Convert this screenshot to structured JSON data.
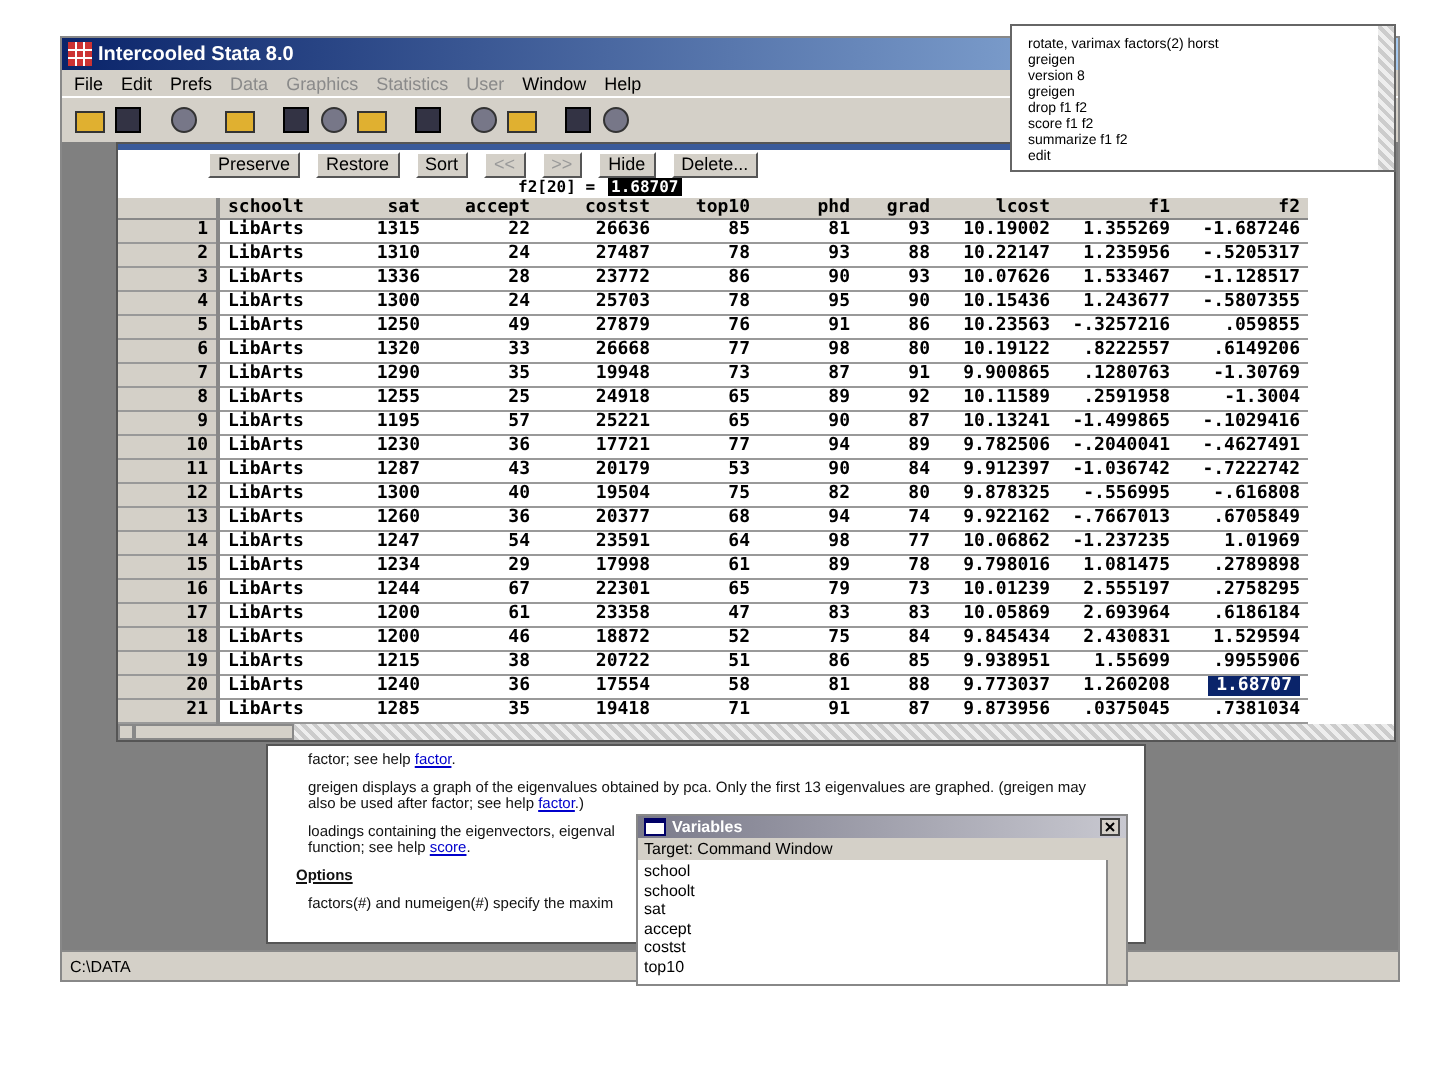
{
  "window": {
    "title": "Intercooled Stata 8.0"
  },
  "menu": [
    {
      "label": "File",
      "disabled": false
    },
    {
      "label": "Edit",
      "disabled": false
    },
    {
      "label": "Prefs",
      "disabled": false
    },
    {
      "label": "Data",
      "disabled": true
    },
    {
      "label": "Graphics",
      "disabled": true
    },
    {
      "label": "Statistics",
      "disabled": true
    },
    {
      "label": "User",
      "disabled": true
    },
    {
      "label": "Window",
      "disabled": false
    },
    {
      "label": "Help",
      "disabled": false
    }
  ],
  "review": {
    "lines": [
      "rotate, varimax factors(2) horst",
      "greigen",
      "version 8",
      "greigen",
      "drop f1 f2",
      "score f1 f2",
      "summarize f1 f2",
      "edit"
    ]
  },
  "data_editor": {
    "buttons": [
      {
        "label": "Preserve",
        "disabled": false
      },
      {
        "label": "Restore",
        "disabled": false
      },
      {
        "label": "Sort",
        "disabled": false
      },
      {
        "label": "<<",
        "disabled": true
      },
      {
        "label": ">>",
        "disabled": true
      },
      {
        "label": "Hide",
        "disabled": false
      },
      {
        "label": "Delete...",
        "disabled": false
      }
    ],
    "cell_reference": "f2[20] =",
    "cell_value": "1.68707",
    "columns": [
      {
        "label": "schoolt",
        "kind": "text"
      },
      {
        "label": "sat",
        "kind": "number"
      },
      {
        "label": "accept",
        "kind": "number"
      },
      {
        "label": "costst",
        "kind": "number"
      },
      {
        "label": "top10",
        "kind": "number"
      },
      {
        "label": "phd",
        "kind": "number"
      },
      {
        "label": "grad",
        "kind": "number"
      },
      {
        "label": "lcost",
        "kind": "number"
      },
      {
        "label": "f1",
        "kind": "number"
      },
      {
        "label": "f2",
        "kind": "number"
      }
    ],
    "rows": [
      {
        "number": "1",
        "cells": [
          {
            "text": "LibArts",
            "selected": false
          },
          {
            "text": "1315",
            "selected": false
          },
          {
            "text": "22",
            "selected": false
          },
          {
            "text": "26636",
            "selected": false
          },
          {
            "text": "85",
            "selected": false
          },
          {
            "text": "81",
            "selected": false
          },
          {
            "text": "93",
            "selected": false
          },
          {
            "text": "10.19002",
            "selected": false
          },
          {
            "text": "1.355269",
            "selected": false
          },
          {
            "text": "-1.687246",
            "selected": false
          }
        ]
      },
      {
        "number": "2",
        "cells": [
          {
            "text": "LibArts",
            "selected": false
          },
          {
            "text": "1310",
            "selected": false
          },
          {
            "text": "24",
            "selected": false
          },
          {
            "text": "27487",
            "selected": false
          },
          {
            "text": "78",
            "selected": false
          },
          {
            "text": "93",
            "selected": false
          },
          {
            "text": "88",
            "selected": false
          },
          {
            "text": "10.22147",
            "selected": false
          },
          {
            "text": "1.235956",
            "selected": false
          },
          {
            "text": "-.5205317",
            "selected": false
          }
        ]
      },
      {
        "number": "3",
        "cells": [
          {
            "text": "LibArts",
            "selected": false
          },
          {
            "text": "1336",
            "selected": false
          },
          {
            "text": "28",
            "selected": false
          },
          {
            "text": "23772",
            "selected": false
          },
          {
            "text": "86",
            "selected": false
          },
          {
            "text": "90",
            "selected": false
          },
          {
            "text": "93",
            "selected": false
          },
          {
            "text": "10.07626",
            "selected": false
          },
          {
            "text": "1.533467",
            "selected": false
          },
          {
            "text": "-1.128517",
            "selected": false
          }
        ]
      },
      {
        "number": "4",
        "cells": [
          {
            "text": "LibArts",
            "selected": false
          },
          {
            "text": "1300",
            "selected": false
          },
          {
            "text": "24",
            "selected": false
          },
          {
            "text": "25703",
            "selected": false
          },
          {
            "text": "78",
            "selected": false
          },
          {
            "text": "95",
            "selected": false
          },
          {
            "text": "90",
            "selected": false
          },
          {
            "text": "10.15436",
            "selected": false
          },
          {
            "text": "1.243677",
            "selected": false
          },
          {
            "text": "-.5807355",
            "selected": false
          }
        ]
      },
      {
        "number": "5",
        "cells": [
          {
            "text": "LibArts",
            "selected": false
          },
          {
            "text": "1250",
            "selected": false
          },
          {
            "text": "49",
            "selected": false
          },
          {
            "text": "27879",
            "selected": false
          },
          {
            "text": "76",
            "selected": false
          },
          {
            "text": "91",
            "selected": false
          },
          {
            "text": "86",
            "selected": false
          },
          {
            "text": "10.23563",
            "selected": false
          },
          {
            "text": "-.3257216",
            "selected": false
          },
          {
            "text": ".059855",
            "selected": false
          }
        ]
      },
      {
        "number": "6",
        "cells": [
          {
            "text": "LibArts",
            "selected": false
          },
          {
            "text": "1320",
            "selected": false
          },
          {
            "text": "33",
            "selected": false
          },
          {
            "text": "26668",
            "selected": false
          },
          {
            "text": "77",
            "selected": false
          },
          {
            "text": "98",
            "selected": false
          },
          {
            "text": "80",
            "selected": false
          },
          {
            "text": "10.19122",
            "selected": false
          },
          {
            "text": ".8222557",
            "selected": false
          },
          {
            "text": ".6149206",
            "selected": false
          }
        ]
      },
      {
        "number": "7",
        "cells": [
          {
            "text": "LibArts",
            "selected": false
          },
          {
            "text": "1290",
            "selected": false
          },
          {
            "text": "35",
            "selected": false
          },
          {
            "text": "19948",
            "selected": false
          },
          {
            "text": "73",
            "selected": false
          },
          {
            "text": "87",
            "selected": false
          },
          {
            "text": "91",
            "selected": false
          },
          {
            "text": "9.900865",
            "selected": false
          },
          {
            "text": ".1280763",
            "selected": false
          },
          {
            "text": "-1.30769",
            "selected": false
          }
        ]
      },
      {
        "number": "8",
        "cells": [
          {
            "text": "LibArts",
            "selected": false
          },
          {
            "text": "1255",
            "selected": false
          },
          {
            "text": "25",
            "selected": false
          },
          {
            "text": "24918",
            "selected": false
          },
          {
            "text": "65",
            "selected": false
          },
          {
            "text": "89",
            "selected": false
          },
          {
            "text": "92",
            "selected": false
          },
          {
            "text": "10.11589",
            "selected": false
          },
          {
            "text": ".2591958",
            "selected": false
          },
          {
            "text": "-1.3004",
            "selected": false
          }
        ]
      },
      {
        "number": "9",
        "cells": [
          {
            "text": "LibArts",
            "selected": false
          },
          {
            "text": "1195",
            "selected": false
          },
          {
            "text": "57",
            "selected": false
          },
          {
            "text": "25221",
            "selected": false
          },
          {
            "text": "65",
            "selected": false
          },
          {
            "text": "90",
            "selected": false
          },
          {
            "text": "87",
            "selected": false
          },
          {
            "text": "10.13241",
            "selected": false
          },
          {
            "text": "-1.499865",
            "selected": false
          },
          {
            "text": "-.1029416",
            "selected": false
          }
        ]
      },
      {
        "number": "10",
        "cells": [
          {
            "text": "LibArts",
            "selected": false
          },
          {
            "text": "1230",
            "selected": false
          },
          {
            "text": "36",
            "selected": false
          },
          {
            "text": "17721",
            "selected": false
          },
          {
            "text": "77",
            "selected": false
          },
          {
            "text": "94",
            "selected": false
          },
          {
            "text": "89",
            "selected": false
          },
          {
            "text": "9.782506",
            "selected": false
          },
          {
            "text": "-.2040041",
            "selected": false
          },
          {
            "text": "-.4627491",
            "selected": false
          }
        ]
      },
      {
        "number": "11",
        "cells": [
          {
            "text": "LibArts",
            "selected": false
          },
          {
            "text": "1287",
            "selected": false
          },
          {
            "text": "43",
            "selected": false
          },
          {
            "text": "20179",
            "selected": false
          },
          {
            "text": "53",
            "selected": false
          },
          {
            "text": "90",
            "selected": false
          },
          {
            "text": "84",
            "selected": false
          },
          {
            "text": "9.912397",
            "selected": false
          },
          {
            "text": "-1.036742",
            "selected": false
          },
          {
            "text": "-.7222742",
            "selected": false
          }
        ]
      },
      {
        "number": "12",
        "cells": [
          {
            "text": "LibArts",
            "selected": false
          },
          {
            "text": "1300",
            "selected": false
          },
          {
            "text": "40",
            "selected": false
          },
          {
            "text": "19504",
            "selected": false
          },
          {
            "text": "75",
            "selected": false
          },
          {
            "text": "82",
            "selected": false
          },
          {
            "text": "80",
            "selected": false
          },
          {
            "text": "9.878325",
            "selected": false
          },
          {
            "text": "-.556995",
            "selected": false
          },
          {
            "text": "-.616808",
            "selected": false
          }
        ]
      },
      {
        "number": "13",
        "cells": [
          {
            "text": "LibArts",
            "selected": false
          },
          {
            "text": "1260",
            "selected": false
          },
          {
            "text": "36",
            "selected": false
          },
          {
            "text": "20377",
            "selected": false
          },
          {
            "text": "68",
            "selected": false
          },
          {
            "text": "94",
            "selected": false
          },
          {
            "text": "74",
            "selected": false
          },
          {
            "text": "9.922162",
            "selected": false
          },
          {
            "text": "-.7667013",
            "selected": false
          },
          {
            "text": ".6705849",
            "selected": false
          }
        ]
      },
      {
        "number": "14",
        "cells": [
          {
            "text": "LibArts",
            "selected": false
          },
          {
            "text": "1247",
            "selected": false
          },
          {
            "text": "54",
            "selected": false
          },
          {
            "text": "23591",
            "selected": false
          },
          {
            "text": "64",
            "selected": false
          },
          {
            "text": "98",
            "selected": false
          },
          {
            "text": "77",
            "selected": false
          },
          {
            "text": "10.06862",
            "selected": false
          },
          {
            "text": "-1.237235",
            "selected": false
          },
          {
            "text": "1.01969",
            "selected": false
          }
        ]
      },
      {
        "number": "15",
        "cells": [
          {
            "text": "LibArts",
            "selected": false
          },
          {
            "text": "1234",
            "selected": false
          },
          {
            "text": "29",
            "selected": false
          },
          {
            "text": "17998",
            "selected": false
          },
          {
            "text": "61",
            "selected": false
          },
          {
            "text": "89",
            "selected": false
          },
          {
            "text": "78",
            "selected": false
          },
          {
            "text": "9.798016",
            "selected": false
          },
          {
            "text": "1.081475",
            "selected": false
          },
          {
            "text": ".2789898",
            "selected": false
          }
        ]
      },
      {
        "number": "16",
        "cells": [
          {
            "text": "LibArts",
            "selected": false
          },
          {
            "text": "1244",
            "selected": false
          },
          {
            "text": "67",
            "selected": false
          },
          {
            "text": "22301",
            "selected": false
          },
          {
            "text": "65",
            "selected": false
          },
          {
            "text": "79",
            "selected": false
          },
          {
            "text": "73",
            "selected": false
          },
          {
            "text": "10.01239",
            "selected": false
          },
          {
            "text": "2.555197",
            "selected": false
          },
          {
            "text": ".2758295",
            "selected": false
          }
        ]
      },
      {
        "number": "17",
        "cells": [
          {
            "text": "LibArts",
            "selected": false
          },
          {
            "text": "1200",
            "selected": false
          },
          {
            "text": "61",
            "selected": false
          },
          {
            "text": "23358",
            "selected": false
          },
          {
            "text": "47",
            "selected": false
          },
          {
            "text": "83",
            "selected": false
          },
          {
            "text": "83",
            "selected": false
          },
          {
            "text": "10.05869",
            "selected": false
          },
          {
            "text": "2.693964",
            "selected": false
          },
          {
            "text": ".6186184",
            "selected": false
          }
        ]
      },
      {
        "number": "18",
        "cells": [
          {
            "text": "LibArts",
            "selected": false
          },
          {
            "text": "1200",
            "selected": false
          },
          {
            "text": "46",
            "selected": false
          },
          {
            "text": "18872",
            "selected": false
          },
          {
            "text": "52",
            "selected": false
          },
          {
            "text": "75",
            "selected": false
          },
          {
            "text": "84",
            "selected": false
          },
          {
            "text": "9.845434",
            "selected": false
          },
          {
            "text": "2.430831",
            "selected": false
          },
          {
            "text": "1.529594",
            "selected": false
          }
        ]
      },
      {
        "number": "19",
        "cells": [
          {
            "text": "LibArts",
            "selected": false
          },
          {
            "text": "1215",
            "selected": false
          },
          {
            "text": "38",
            "selected": false
          },
          {
            "text": "20722",
            "selected": false
          },
          {
            "text": "51",
            "selected": false
          },
          {
            "text": "86",
            "selected": false
          },
          {
            "text": "85",
            "selected": false
          },
          {
            "text": "9.938951",
            "selected": false
          },
          {
            "text": "1.55699",
            "selected": false
          },
          {
            "text": ".9955906",
            "selected": false
          }
        ]
      },
      {
        "number": "20",
        "cells": [
          {
            "text": "LibArts",
            "selected": false
          },
          {
            "text": "1240",
            "selected": false
          },
          {
            "text": "36",
            "selected": false
          },
          {
            "text": "17554",
            "selected": false
          },
          {
            "text": "58",
            "selected": false
          },
          {
            "text": "81",
            "selected": false
          },
          {
            "text": "88",
            "selected": false
          },
          {
            "text": "9.773037",
            "selected": false
          },
          {
            "text": "1.260208",
            "selected": false
          },
          {
            "text": "1.68707",
            "selected": true
          }
        ]
      },
      {
        "number": "21",
        "cells": [
          {
            "text": "LibArts",
            "selected": false
          },
          {
            "text": "1285",
            "selected": false
          },
          {
            "text": "35",
            "selected": false
          },
          {
            "text": "19418",
            "selected": false
          },
          {
            "text": "71",
            "selected": false
          },
          {
            "text": "91",
            "selected": false
          },
          {
            "text": "87",
            "selected": false
          },
          {
            "text": "9.873956",
            "selected": false
          },
          {
            "text": ".0375045",
            "selected": false
          },
          {
            "text": ".7381034",
            "selected": false
          }
        ]
      }
    ]
  },
  "help": {
    "blocks": [
      {
        "kind": "paragraph",
        "lines": [
          [
            {
              "text": "factor; see help ",
              "kind": "plain"
            },
            {
              "text": "factor",
              "kind": "link"
            },
            {
              "text": ".",
              "kind": "plain"
            }
          ]
        ]
      },
      {
        "kind": "paragraph",
        "lines": [
          [
            {
              "text": "greigen displays a graph of the eigenvalues obtained by pca. Only the first 13 eigenvalues are graphed. (greigen may",
              "kind": "plain"
            }
          ],
          [
            {
              "text": "also be used after factor; see help ",
              "kind": "plain"
            },
            {
              "text": "factor",
              "kind": "link"
            },
            {
              "text": ".)",
              "kind": "plain"
            }
          ]
        ]
      },
      {
        "kind": "paragraph",
        "lines": [
          [
            {
              "text": "loadings containing the eigenvectors, eigenval",
              "kind": "plain"
            }
          ],
          [
            {
              "text": "function; see help ",
              "kind": "plain"
            },
            {
              "text": "score",
              "kind": "link"
            },
            {
              "text": ".",
              "kind": "plain"
            }
          ]
        ]
      },
      {
        "kind": "heading",
        "lines": [
          [
            {
              "text": "Options",
              "kind": "plain"
            }
          ]
        ]
      },
      {
        "kind": "paragraph",
        "lines": [
          [
            {
              "text": "factors(#) and numeigen(#) specify the maxim",
              "kind": "plain"
            }
          ]
        ]
      }
    ]
  },
  "variables": {
    "title": "Variables",
    "target": "Target: Command Window",
    "items": [
      "school",
      "schoolt",
      "sat",
      "accept",
      "costst",
      "top10"
    ]
  },
  "status_bar": {
    "path": "C:\\DATA"
  }
}
